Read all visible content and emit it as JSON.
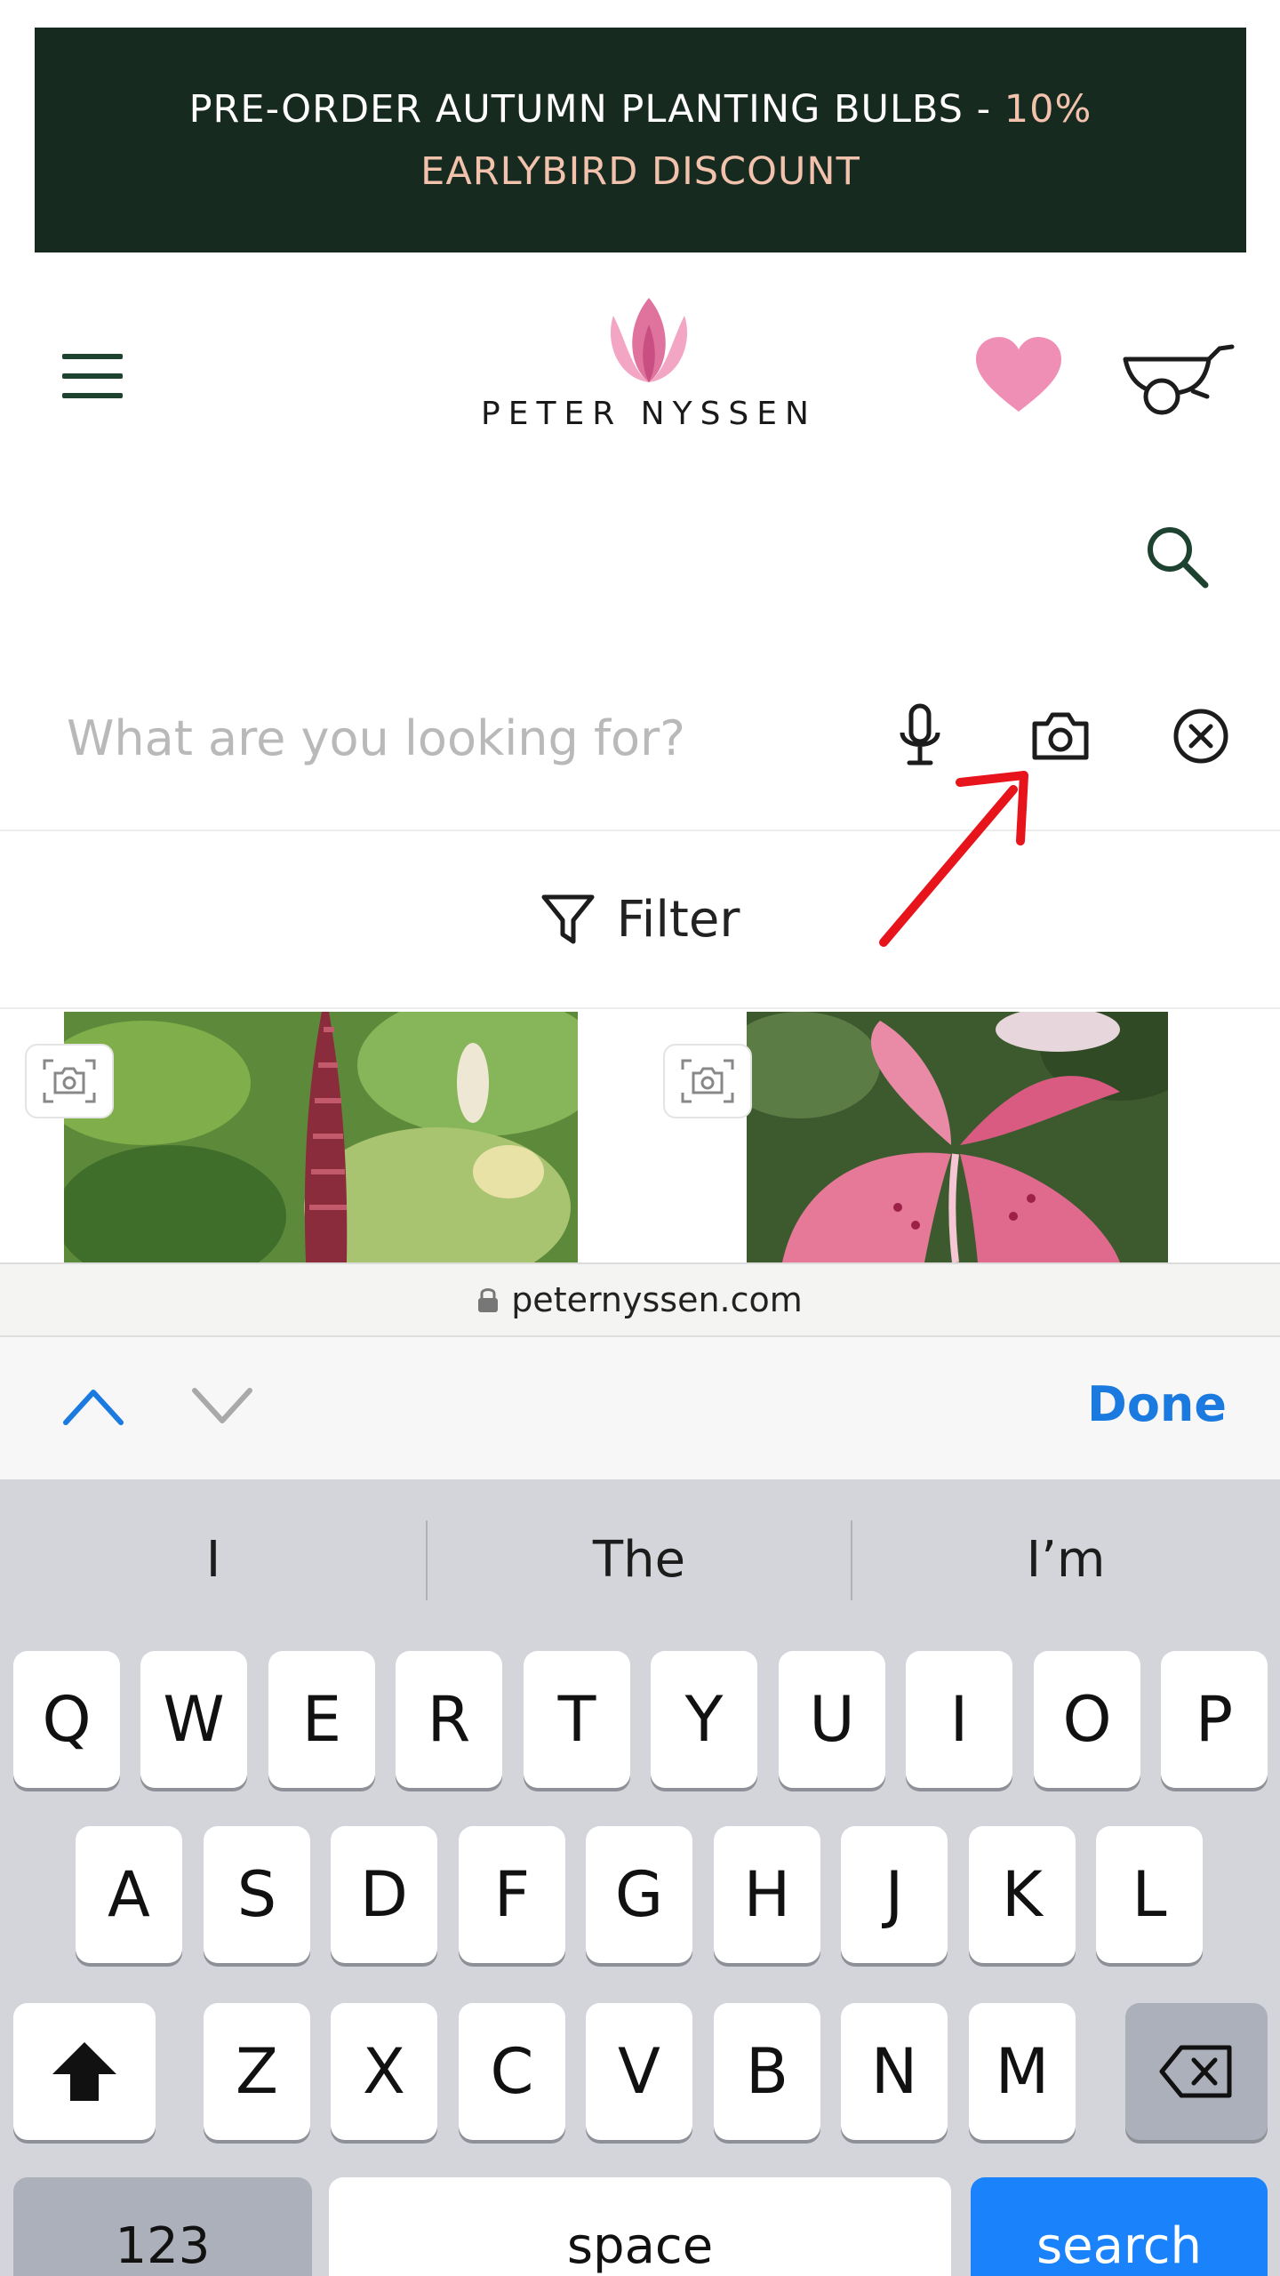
{
  "banner": {
    "line1": "PRE-ORDER AUTUMN PLANTING BULBS - ",
    "line1_accent": "10%",
    "line2_accent": "EARLYBIRD DISCOUNT"
  },
  "header": {
    "brand": "PETER NYSSEN"
  },
  "search": {
    "value": "",
    "placeholder": "What are you looking for?"
  },
  "filter": {
    "label": "Filter"
  },
  "browser": {
    "url": "peternyssen.com"
  },
  "accessory": {
    "done_label": "Done"
  },
  "keyboard": {
    "suggestions": [
      "I",
      "The",
      "I’m"
    ],
    "row1": [
      "Q",
      "W",
      "E",
      "R",
      "T",
      "Y",
      "U",
      "I",
      "O",
      "P"
    ],
    "row2": [
      "A",
      "S",
      "D",
      "F",
      "G",
      "H",
      "J",
      "K",
      "L"
    ],
    "row3": [
      "Z",
      "X",
      "C",
      "V",
      "B",
      "N",
      "M"
    ],
    "numbers_label": "123",
    "space_label": "space",
    "search_label": "search"
  },
  "colors": {
    "banner_bg": "#172a1f",
    "banner_accent": "#f2c2ac",
    "brand_green": "#1e4230",
    "heart_pink": "#ef8fb6",
    "link_blue": "#1a7ae0",
    "annotation_red": "#e8141c"
  },
  "icons": [
    "menu-icon",
    "logo-tulip-icon",
    "heart-icon",
    "cart-icon",
    "search-icon",
    "microphone-icon",
    "camera-icon",
    "clear-icon",
    "filter-icon",
    "lock-icon",
    "chevron-up-icon",
    "chevron-down-icon",
    "shift-icon",
    "backspace-icon"
  ]
}
